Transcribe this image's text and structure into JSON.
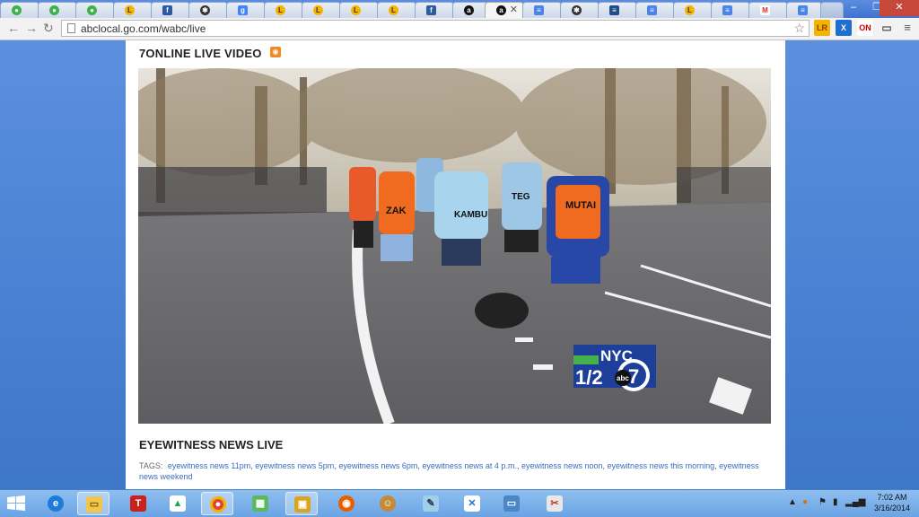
{
  "browser": {
    "active_tab_title": "",
    "url": "abclocal.go.com/wabc/live",
    "extensions": [
      "lr-extension-icon",
      "xmarks-icon",
      "cnn-on-icon",
      "cast-icon",
      "chrome-menu-icon"
    ]
  },
  "page": {
    "live_heading": "7ONLINE LIVE VIDEO",
    "news_heading": "EYEWITNESS NEWS LIVE",
    "tags_label": "TAGS:",
    "tags": [
      "eyewitness news 11pm",
      "eyewitness news 5pm",
      "eyewitness news 6pm",
      "eyewitness news at 4 p.m.",
      "eyewitness news noon",
      "eyewitness news this morning",
      "eyewitness news weekend"
    ],
    "video": {
      "overlay_city": "NYC",
      "overlay_event": "1/2",
      "overlay_network": "abc",
      "overlay_channel": "7",
      "bib_labels": [
        "ZAK",
        "KAMBU",
        "TEG",
        "MUTAI"
      ]
    }
  },
  "taskbar": {
    "time": "7:02 AM",
    "date": "3/16/2014"
  },
  "colors": {
    "accent": "#3a6dbf",
    "page_bg": "#4f86d6",
    "tag_link": "#3a6dbf"
  }
}
